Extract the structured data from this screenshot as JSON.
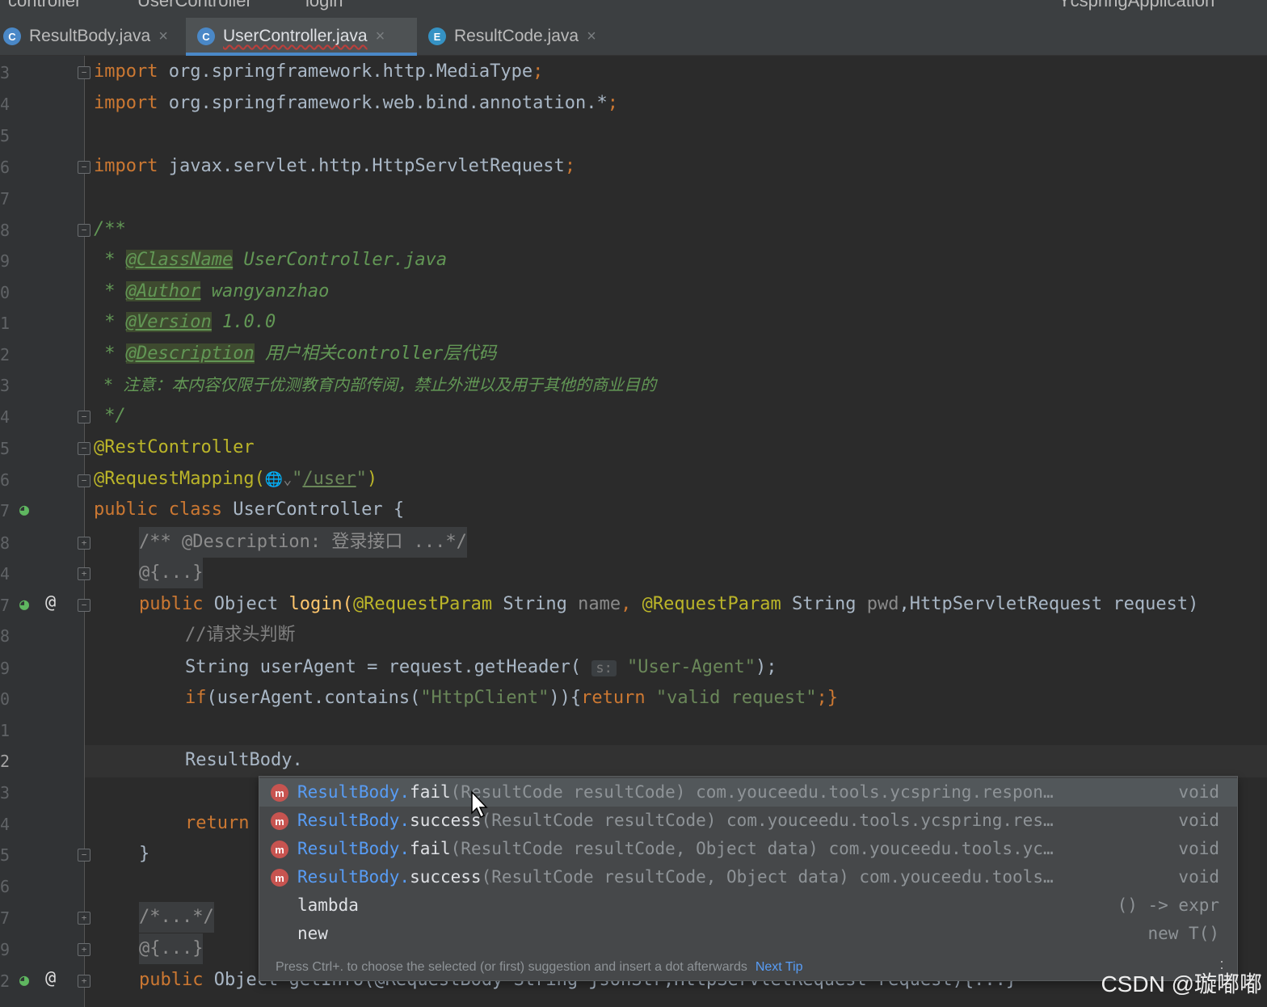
{
  "breadcrumb": {
    "item1": "controller",
    "item2": "UserController",
    "item3": "login"
  },
  "run_config": "YcspringApplication",
  "tabs": [
    {
      "icon": "C",
      "label": "ResultBody.java",
      "color": "#4a88c7"
    },
    {
      "icon": "C",
      "label": "UserController.java",
      "color": "#4a88c7"
    },
    {
      "icon": "E",
      "label": "ResultCode.java",
      "color": "#3592c4"
    }
  ],
  "tab_close": "×",
  "line_numbers": [
    "3",
    "4",
    "5",
    "6",
    "7",
    "8",
    "9",
    "0",
    "1",
    "2",
    "3",
    "4",
    "5",
    "6",
    "7",
    "8",
    "4",
    "7",
    "8",
    "9",
    "0",
    "1",
    "2",
    "3",
    "4",
    "5",
    "6",
    "7",
    "9",
    "2"
  ],
  "code": {
    "l1_kw": "import",
    "l1_rest": " org.springframework.http.MediaType",
    "l1_semi": ";",
    "l2_kw": "import",
    "l2_rest": " org.springframework.web.bind.annotation.*",
    "l2_semi": ";",
    "l3_kw": "import",
    "l3_rest": " javax.servlet.http.HttpServletRequest",
    "l3_semi": ";",
    "l4": "/**",
    "l5_star": " * ",
    "l5_tag": "@ClassName",
    "l5_text": " UserController.java",
    "l6_star": " * ",
    "l6_tag": "@Author",
    "l6_text": " wangyanzhao",
    "l7_star": " * ",
    "l7_tag": "@Version",
    "l7_text": " 1.0.0",
    "l8_star": " * ",
    "l8_tag": "@Description",
    "l8_text": " 用户相关controller层代码",
    "l9": " * 注意：本内容仅限于优测教育内部传阅，禁止外泄以及用于其他的商业目的",
    "l10": " */",
    "l11": "@RestController",
    "l12_ann": "@RequestMapping(",
    "l12_globe": "🌐⌄",
    "l12_q1": "\"",
    "l12_path": "/user",
    "l12_q2": "\"",
    "l12_close": ")",
    "l13_kw": "public class",
    "l13_rest": " UserController {",
    "l14": "/** @Description: 登录接口 ...*/",
    "l15": "@{...}",
    "l16_kw": "public",
    "l16_a": " Object ",
    "l16_fn": "login(",
    "l16_ann1": "@RequestParam",
    "l16_b": " String ",
    "l16_p1": "name",
    "l16_c": ", ",
    "l16_ann2": "@RequestParam",
    "l16_d": " String ",
    "l16_p2": "pwd",
    "l16_e": ",HttpServletRequest request)",
    "l17": "//请求头判断",
    "l18_a": "String userAgent = request.getHeader( ",
    "l18_hint": "s:",
    "l18_str": " \"User-Agent\"",
    "l18_b": ");",
    "l19_kw": "if",
    "l19_a": "(userAgent.contains(",
    "l19_str1": "\"HttpClient\"",
    "l19_b": ")){",
    "l19_kw2": "return",
    "l19_str2": " \"valid request\"",
    "l19_c": ";}",
    "l21": "ResultBody.",
    "l23_kw": "return",
    "l24": "}",
    "l26": "/*...*/",
    "l27": "@{...}",
    "l28_kw": "public",
    "l28_a": " Object getInfo(@RequestBody String jsonStr,HttpServletRequest request){...}"
  },
  "completion": {
    "items": [
      {
        "icon": "m",
        "cls": "ResultBody.",
        "name": "fail",
        "sig": "(ResultCode resultCode) com.youceedu.tools.ycspring.respon…",
        "type": "void"
      },
      {
        "icon": "m",
        "cls": "ResultBody.",
        "name": "success",
        "sig": "(ResultCode resultCode) com.youceedu.tools.ycspring.res…",
        "type": "void"
      },
      {
        "icon": "m",
        "cls": "ResultBody.",
        "name": "fail",
        "sig": "(ResultCode resultCode, Object data) com.youceedu.tools.yc…",
        "type": "void"
      },
      {
        "icon": "m",
        "cls": "ResultBody.",
        "name": "success",
        "sig": "(ResultCode resultCode, Object data) com.youceedu.tools…",
        "type": "void"
      },
      {
        "icon": "",
        "cls": "",
        "name": "lambda",
        "sig": "",
        "type": "() -> expr"
      },
      {
        "icon": "",
        "cls": "",
        "name": "new",
        "sig": "",
        "type": "new T()"
      }
    ],
    "footer_text": "Press Ctrl+. to choose the selected (or first) suggestion and insert a dot afterwards",
    "footer_link": "Next Tip"
  },
  "watermark": "CSDN @璇嘟嘟"
}
